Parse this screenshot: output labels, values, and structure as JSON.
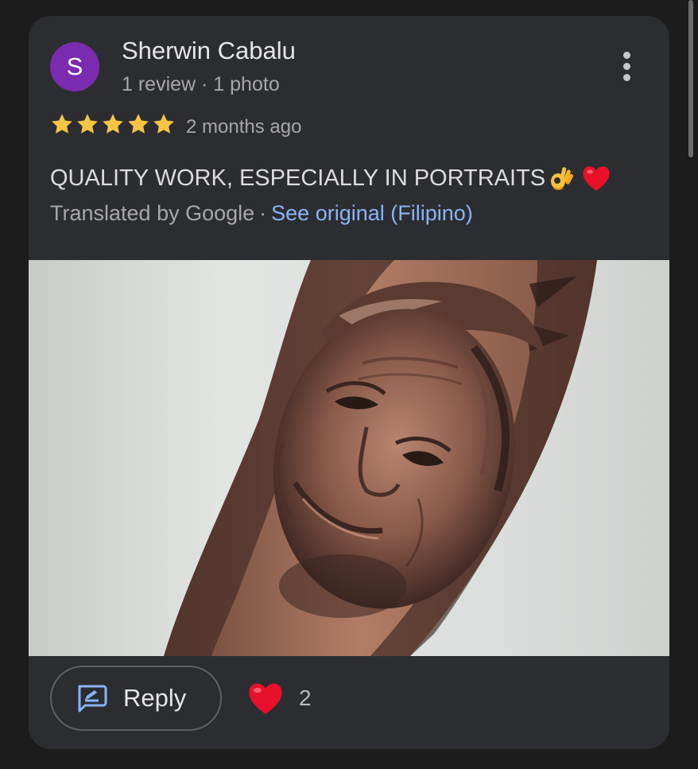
{
  "review": {
    "avatar_initial": "S",
    "author_name": "Sherwin Cabalu",
    "author_meta": "1 review · 1 photo",
    "rating": 5,
    "rating_max": 5,
    "date": "2 months ago",
    "text": "QUALITY WORK, ESPECIALLY IN PORTRAITS",
    "text_emojis": [
      "ok-hand-emoji",
      "red-heart-emoji"
    ],
    "translated_by": "Translated by Google",
    "separator": "·",
    "see_original": "See original (Filipino)"
  },
  "actions": {
    "reply_label": "Reply",
    "like_count": "2",
    "more_menu": "more-vert-icon"
  },
  "colors": {
    "background": "#1c1c1d",
    "card": "#2c2d30",
    "avatar": "#7b2bb0",
    "star": "#f6c445",
    "link": "#8ab4f8",
    "heart": "#e8102a"
  }
}
